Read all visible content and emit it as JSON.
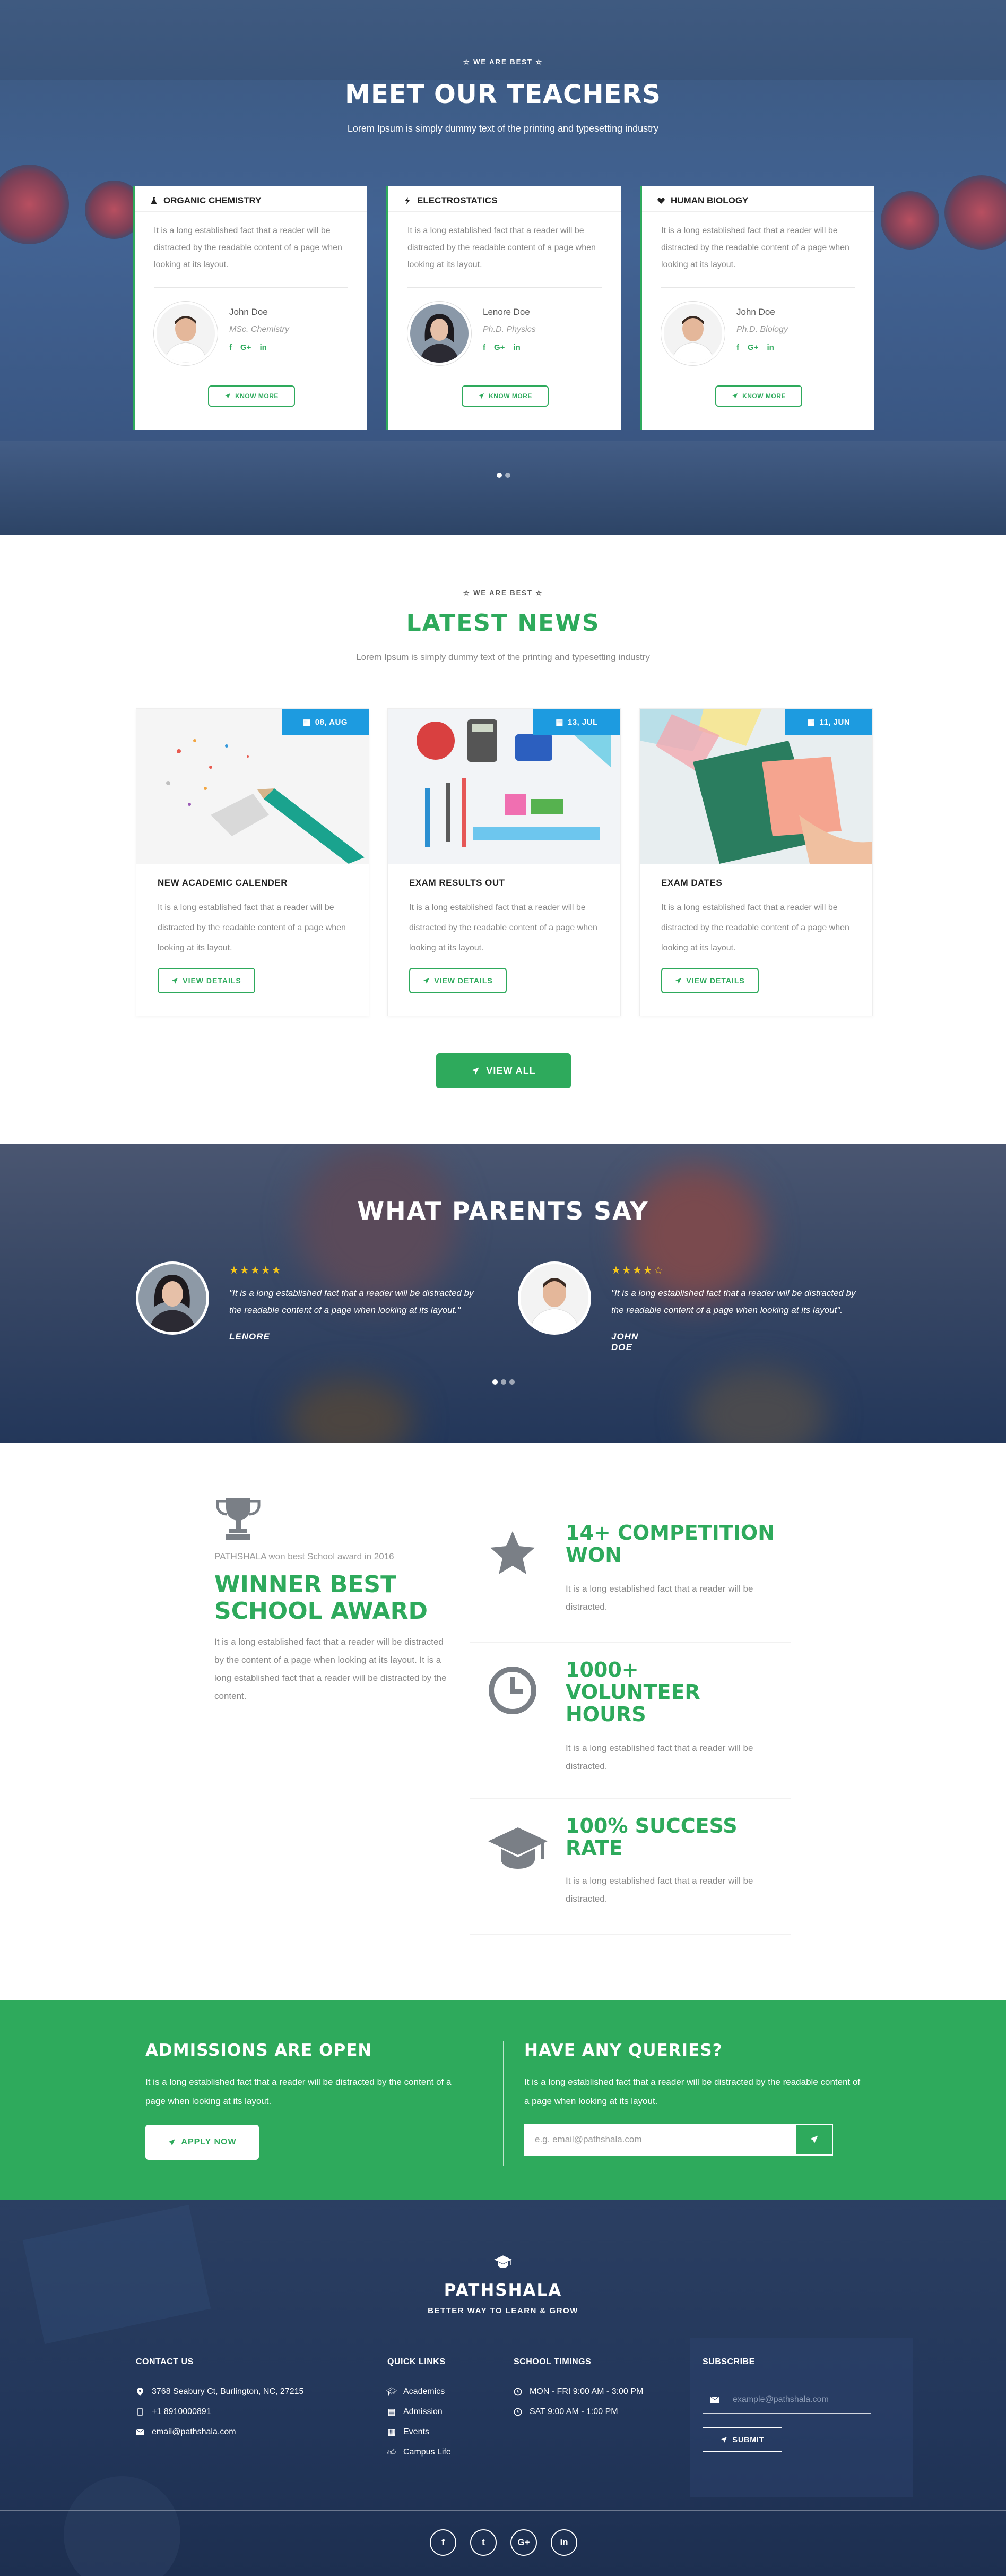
{
  "teachers": {
    "eyebrow": "WE ARE BEST",
    "title": "MEET OUR TEACHERS",
    "subtitle": "Lorem Ipsum is simply dummy text of the printing and typesetting industry",
    "cards": [
      {
        "subject": "ORGANIC CHEMISTRY",
        "icon": "flask-icon",
        "desc": "It is a long established fact that a reader will be distracted by the readable content of a page when looking at its layout.",
        "name": "John Doe",
        "role": "MSc. Chemistry",
        "button": "KNOW MORE"
      },
      {
        "subject": "ELECTROSTATICS",
        "icon": "bolt-icon",
        "desc": "It is a long established fact that a reader will be distracted by the readable content of a page when looking at its layout.",
        "name": "Lenore Doe",
        "role": "Ph.D. Physics",
        "button": "KNOW MORE"
      },
      {
        "subject": "HUMAN BIOLOGY",
        "icon": "heartbeat-icon",
        "desc": "It is a long established fact that a reader will be distracted by the readable content of a page when looking at its layout.",
        "name": "John Doe",
        "role": "Ph.D. Biology",
        "button": "KNOW MORE"
      }
    ],
    "social": {
      "facebook": "f",
      "google": "G+",
      "linkedin": "in"
    }
  },
  "news": {
    "eyebrow": "WE ARE BEST",
    "title": "LATEST NEWS",
    "subtitle": "Lorem Ipsum is simply dummy text of the printing and typesetting industry",
    "items": [
      {
        "date": "08, AUG",
        "title": "NEW ACADEMIC CALENDER",
        "desc": "It is a long established fact that a reader will be distracted by the readable content of a page when looking at its layout.",
        "button": "VIEW DETAILS"
      },
      {
        "date": "13, JUL",
        "title": "EXAM RESULTS OUT",
        "desc": "It is a long established fact that a reader will be distracted by the readable content of a page when looking at its layout.",
        "button": "VIEW DETAILS"
      },
      {
        "date": "11, JUN",
        "title": "EXAM DATES",
        "desc": "It is a long established fact that a reader will be distracted by the readable content of a page when looking at its layout.",
        "button": "VIEW DETAILS"
      }
    ],
    "view_all": "VIEW ALL"
  },
  "parents": {
    "title": "WHAT PARENTS SAY",
    "quotes": [
      {
        "stars": "★★★★★",
        "rating": 5,
        "text": "\"It is a long established fact that a reader will be distracted by the readable content of a page when looking at its layout.\"",
        "name": "LENORE"
      },
      {
        "stars": "★★★★☆",
        "rating": 4,
        "text": "\"It is a long established fact that a reader will be distracted by the readable content of a page when looking at its layout\".",
        "name": "JOHN DOE"
      }
    ]
  },
  "awards": {
    "small": "PATHSHALA won best School award in 2016",
    "title": "WINNER BEST SCHOOL AWARD",
    "desc": "It is a long established fact that a reader will be distracted by the content of a page when looking at its layout. It is a long established fact that a reader will be distracted by the content.",
    "stats": [
      {
        "number": "14+ COMPETITION WON",
        "icon": "star-icon",
        "desc": "It is a long established fact that a reader will be distracted."
      },
      {
        "number": "1000+ VOLUNTEER HOURS",
        "icon": "clock-icon",
        "desc": "It is a long established fact that a reader will be distracted."
      },
      {
        "number": "100% SUCCESS RATE",
        "icon": "graduation-cap-icon",
        "desc": "It is a long established fact that a reader will be distracted."
      }
    ]
  },
  "admission": {
    "title": "ADMISSIONS ARE OPEN",
    "desc": "It is a long established fact that a reader will be distracted by the content of a page when looking at its layout.",
    "button": "APPLY NOW",
    "query_title": "HAVE ANY QUERIES?",
    "query_desc": "It is a long established fact that a reader will be distracted by the readable content of a page when looking at its layout.",
    "email_placeholder": "e.g. email@pathshala.com"
  },
  "footer": {
    "brand": "PATHSHALA",
    "tagline": "BETTER WAY TO LEARN & GROW",
    "contact": {
      "heading": "CONTACT US",
      "address": "3768 Seabury Ct, Burlington, NC, 27215",
      "phone": "+1 8910000891",
      "email": "email@pathshala.com"
    },
    "links": {
      "heading": "QUICK LINKS",
      "items": [
        "Academics",
        "Admission",
        "Events",
        "Campus Life"
      ]
    },
    "timings": {
      "heading": "SCHOOL TIMINGS",
      "weekday": "MON - FRI 9:00 AM - 3:00 PM",
      "saturday": "SAT 9:00 AM - 1:00 PM"
    },
    "subscribe": {
      "heading": "SUBSCRIBE",
      "placeholder": "example@pathshala.com",
      "button": "SUBMIT"
    },
    "social": [
      "f",
      "t",
      "G+",
      "in"
    ]
  },
  "colors": {
    "accent": "#2eaa5c",
    "date_badge": "#1d9be0",
    "navy": "#22365a"
  }
}
